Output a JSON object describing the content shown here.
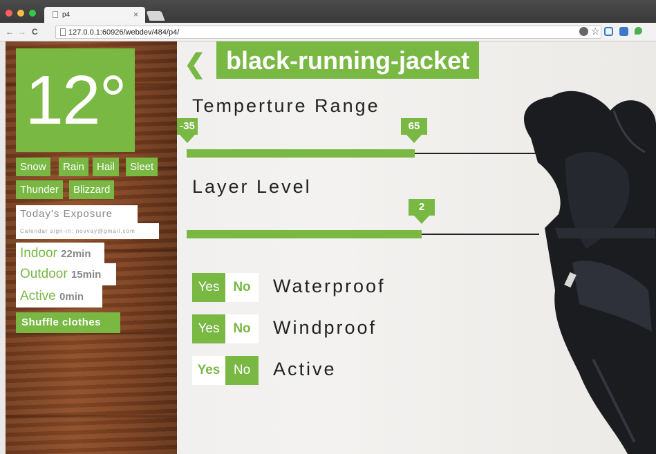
{
  "browser": {
    "tab_title": "p4",
    "tab_close": "×",
    "url": "127.0.0.1:60926/webdev/484/p4/"
  },
  "weather": {
    "temperature": "12°",
    "conditions": [
      "Snow",
      "Rain",
      "Hail",
      "Sleet",
      "Thunder",
      "Blizzard"
    ]
  },
  "exposure": {
    "title": "Today's Exposure",
    "calendar": "Calendar sign-in: novvay@gmail.com",
    "items": [
      {
        "label": "Indoor",
        "value": "22min"
      },
      {
        "label": "Outdoor",
        "value": "15min"
      },
      {
        "label": "Active",
        "value": "0min"
      }
    ]
  },
  "shuffle_label": "Shuffle clothes",
  "item": {
    "back": "❮",
    "title": "black-running-jacket"
  },
  "temperature_range": {
    "label": "Temperture Range",
    "min": "-35",
    "max": "65"
  },
  "layer": {
    "label": "Layer Level",
    "value": "2"
  },
  "properties": [
    {
      "name": "Waterproof",
      "yes": "Yes",
      "no": "No",
      "selected": "yes"
    },
    {
      "name": "Windproof",
      "yes": "Yes",
      "no": "No",
      "selected": "yes"
    },
    {
      "name": "Active",
      "yes": "Yes",
      "no": "No",
      "selected": "no"
    }
  ],
  "colors": {
    "accent": "#78b843",
    "wood": "#7a3f20"
  }
}
